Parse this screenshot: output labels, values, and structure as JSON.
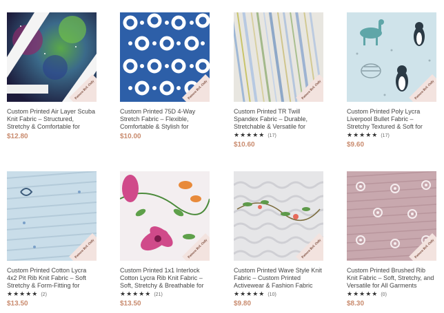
{
  "products": [
    {
      "title": "Custom Printed Air Layer Scuba Knit Fabric – Structured, Stretchy & Comfortable for",
      "price": "$12.80",
      "rating_count": null,
      "image": "galaxy-print",
      "badge": "Pattern Ref. Only"
    },
    {
      "title": "Custom Printed 75D 4-Way Stretch Fabric – Flexible, Comfortable & Stylish for",
      "price": "$10.00",
      "rating_count": null,
      "image": "blue-circle-print",
      "badge": "Pattern Ref. Only"
    },
    {
      "title": "Custom Printed TR Twill Spandex Fabric – Durable, Stretchable & Versatile for",
      "price": "$10.60",
      "rating_count": "(17)",
      "stars": "★★★★★",
      "image": "stripe-print",
      "badge": "Pattern Ref. Only"
    },
    {
      "title": "Custom Printed Poly Lycra Liverpool Bullet Fabric – Stretchy Textured & Soft for",
      "price": "$9.60",
      "rating_count": "(17)",
      "stars": "★★★★★",
      "image": "animal-print",
      "badge": "Pattern Ref. Only"
    },
    {
      "title": "Custom Printed Cotton Lycra 4x2 Pit Rib Knit Fabric – Soft Stretchy & Form-Fitting for",
      "price": "$13.50",
      "rating_count": "(2)",
      "stars": "★★★★★",
      "image": "moon-rib-print",
      "badge": "Pattern Ref. Only"
    },
    {
      "title": "Custom Printed 1x1 Interlock Cotton Lycra Rib Knit Fabric – Soft, Stretchy & Breathable for",
      "price": "$13.50",
      "rating_count": "(21)",
      "stars": "★★★★★",
      "image": "floral-print",
      "badge": "Pattern Ref. Only"
    },
    {
      "title": "Custom Printed Wave Style Knit Fabric – Custom Printed Activewear & Fashion Fabric",
      "price": "$9.80",
      "rating_count": "(10)",
      "stars": "★★★★★",
      "image": "wave-vine-print",
      "badge": "Pattern Ref. Only"
    },
    {
      "title": "Custom Printed Brushed Rib Knit Fabric – Soft, Stretchy, and Versatile for All Garments",
      "price": "$8.30",
      "rating_count": "(0)",
      "stars": "★★★★★",
      "image": "pink-flower-rib-print",
      "badge": "Pattern Ref. Only"
    }
  ]
}
